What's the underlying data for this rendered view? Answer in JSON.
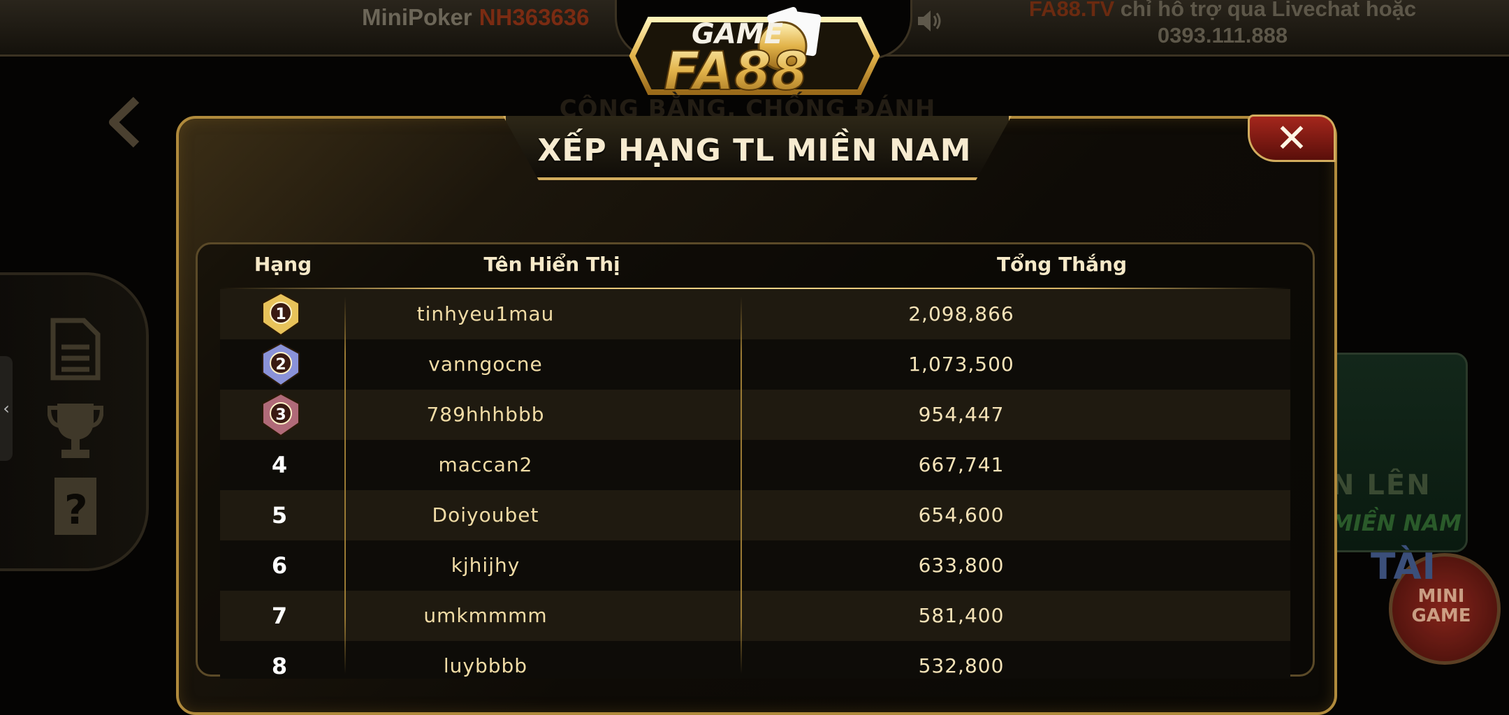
{
  "topbar": {
    "game_label": "MiniPoker",
    "game_code": "NH363636",
    "marquee_brand": "FA88.TV",
    "marquee_text": " chỉ hỗ trợ qua Livechat hoặc",
    "marquee_phone": "0393.111.888"
  },
  "logo": {
    "line1": "GAME",
    "line2": "FA88"
  },
  "background": {
    "slogan": "CÔNG BẰNG, CHỐNG ĐÁNH VÂY",
    "card_title": "N LÊN",
    "card_subtitle": "MIỀN NAM",
    "tai_label": "TÀI",
    "mini_game_label": "MINI GAME"
  },
  "modal": {
    "title": "XẾP HẠNG TL MIỀN NAM",
    "close_label": "✕"
  },
  "table": {
    "headers": {
      "rank": "Hạng",
      "name": "Tên Hiển Thị",
      "total": "Tổng Thắng"
    },
    "rows": [
      {
        "rank": "1",
        "name": "tinhyeu1mau",
        "total": "2,098,866",
        "medal": "gold"
      },
      {
        "rank": "2",
        "name": "vanngocne",
        "total": "1,073,500",
        "medal": "silver"
      },
      {
        "rank": "3",
        "name": "789hhhbbb",
        "total": "954,447",
        "medal": "bronze"
      },
      {
        "rank": "4",
        "name": "maccan2",
        "total": "667,741"
      },
      {
        "rank": "5",
        "name": "Doiyoubet",
        "total": "654,600"
      },
      {
        "rank": "6",
        "name": "kjhijhy",
        "total": "633,800"
      },
      {
        "rank": "7",
        "name": "umkmmmm",
        "total": "581,400"
      },
      {
        "rank": "8",
        "name": "luybbbb",
        "total": "532,800"
      }
    ]
  },
  "colors": {
    "gold": "#d2ac5e",
    "medal_gold": "#e8c25a",
    "medal_silver": "#8a92d8",
    "medal_bronze": "#b06a78",
    "close_red": "#a4261c"
  },
  "icons": [
    "speaker-icon",
    "back-arrow-icon",
    "document-icon",
    "trophy-icon",
    "help-icon",
    "close-icon",
    "rank-medal-icon"
  ]
}
